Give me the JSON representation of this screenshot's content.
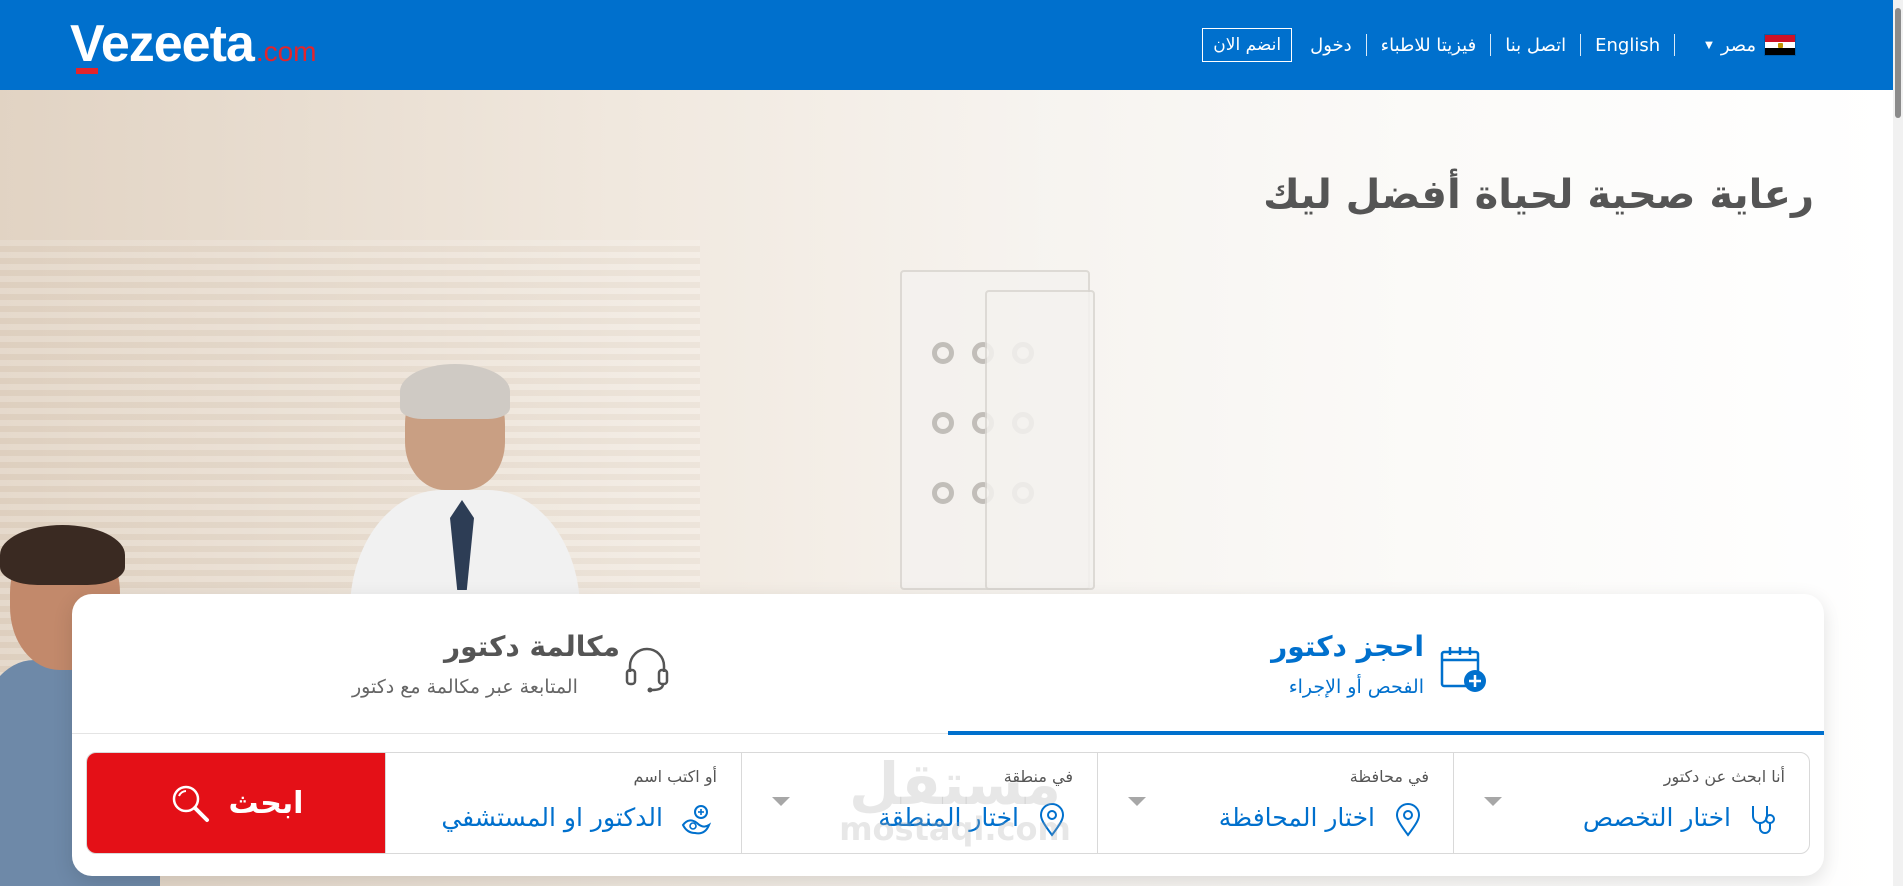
{
  "header": {
    "logo_text": "Vezeeta",
    "logo_suffix": ".com",
    "country": "مصر",
    "language": "English",
    "contact": "اتصل بنا",
    "doctors": "فيزيتا للاطباء",
    "login": "دخول",
    "join": "انضم الان"
  },
  "hero": {
    "title": "رعاية صحية لحياة أفضل ليك"
  },
  "tabs": {
    "book": {
      "title": "احجز دكتور",
      "subtitle": "الفحص أو الإجراء"
    },
    "call": {
      "title": "مكالمة دكتور",
      "subtitle": "المتابعة عبر مكالمة مع دكتور"
    }
  },
  "search": {
    "specialty": {
      "label": "أنا ابحث عن دكتور",
      "value": "اختار التخصص"
    },
    "governorate": {
      "label": "في محافظة",
      "value": "اختار المحافظة"
    },
    "area": {
      "label": "في منطقة",
      "value": "اختار المنطقة"
    },
    "name": {
      "label": "أو اكتب اسم",
      "value": "الدكتور او المستشفي"
    },
    "button": "ابحث"
  },
  "watermark": {
    "ar": "مستقل",
    "en": "mostaql.com"
  },
  "colors": {
    "brand_blue": "#0070cd",
    "search_red": "#e41017",
    "logo_red": "#e3242b"
  }
}
